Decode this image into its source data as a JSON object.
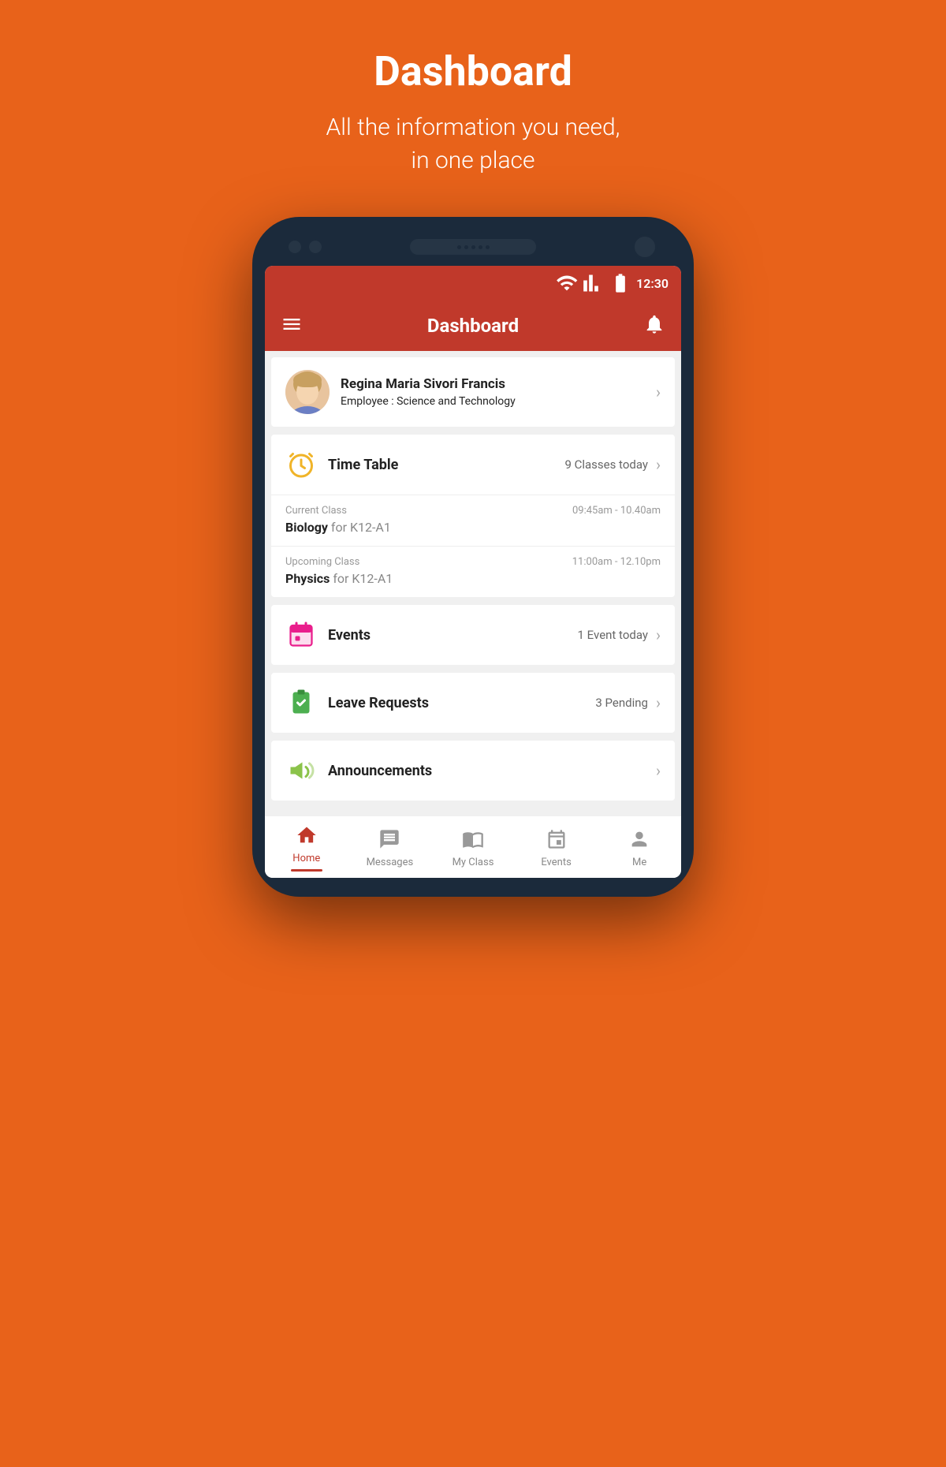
{
  "page": {
    "title": "Dashboard",
    "subtitle_line1": "All the information you need,",
    "subtitle_line2": "in one place"
  },
  "status_bar": {
    "time": "12:30"
  },
  "app_bar": {
    "title": "Dashboard"
  },
  "user": {
    "name": "Regina Maria Sivori Francis",
    "role_label": "Employee : ",
    "role_value": "Science and Technology"
  },
  "sections": {
    "timetable": {
      "title": "Time Table",
      "count": "9 Classes today",
      "current_class": {
        "label": "Current Class",
        "time": "09:45am - 10.40am",
        "subject": "Biology",
        "class_for": "for K12-A1"
      },
      "upcoming_class": {
        "label": "Upcoming Class",
        "time": "11:00am - 12.10pm",
        "subject": "Physics",
        "class_for": "for K12-A1"
      }
    },
    "events": {
      "title": "Events",
      "count": "1 Event today"
    },
    "leave_requests": {
      "title": "Leave Requests",
      "count": "3 Pending"
    },
    "announcements": {
      "title": "Announcements"
    }
  },
  "bottom_nav": {
    "items": [
      {
        "id": "home",
        "label": "Home",
        "active": true
      },
      {
        "id": "messages",
        "label": "Messages",
        "active": false
      },
      {
        "id": "myclass",
        "label": "My Class",
        "active": false
      },
      {
        "id": "events",
        "label": "Events",
        "active": false
      },
      {
        "id": "me",
        "label": "Me",
        "active": false
      }
    ]
  }
}
